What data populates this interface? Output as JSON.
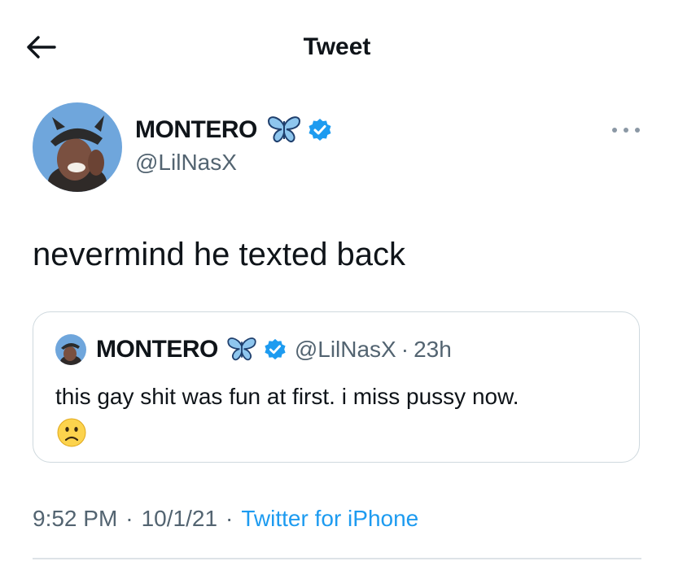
{
  "header": {
    "title": "Tweet",
    "back_icon": "arrow-left-icon"
  },
  "tweet": {
    "author": {
      "display_name": "MONTERO",
      "handle": "@LilNasX",
      "name_emoji": "butterfly-icon",
      "verified_icon": "verified-badge-icon",
      "verified_color": "#1d9bf0"
    },
    "more_icon": "more-horizontal-icon",
    "text": "nevermind he texted back",
    "quoted": {
      "display_name": "MONTERO",
      "handle": "@LilNasX",
      "separator": "·",
      "time": "23h",
      "text": "this gay shit was fun at first. i miss pussy now.",
      "emoji": "slightly-frowning-face-icon"
    },
    "meta": {
      "time": "9:52 PM",
      "separator": "·",
      "date": "10/1/21",
      "source": "Twitter for iPhone",
      "source_color": "#1d9bf0"
    }
  },
  "colors": {
    "text_primary": "#0f1419",
    "text_secondary": "#536471",
    "accent": "#1d9bf0",
    "border": "#cfd9de"
  }
}
